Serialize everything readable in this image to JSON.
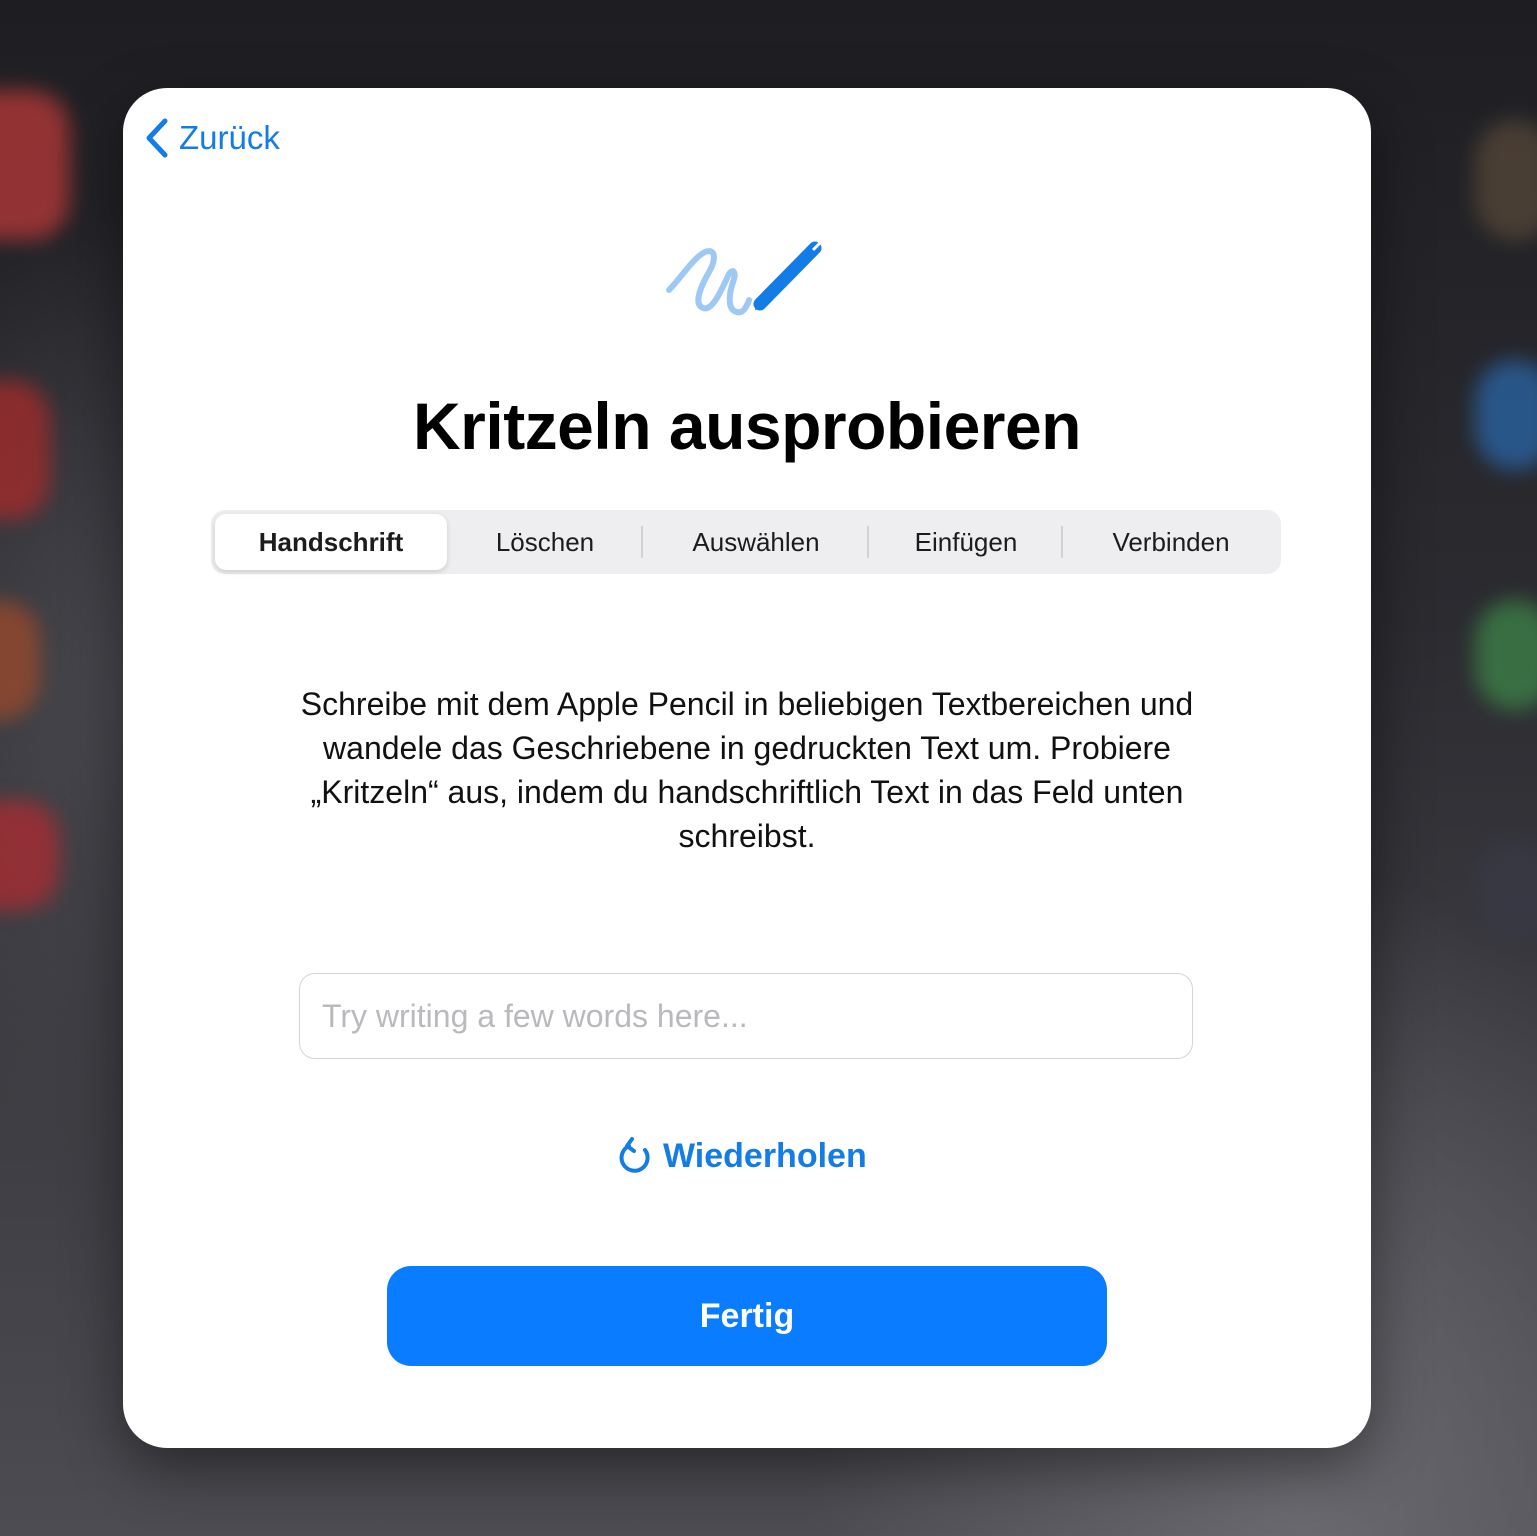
{
  "dialog": {
    "back_label": "Zurück",
    "icon": "scribble-pencil-icon",
    "title": "Kritzeln ausprobieren",
    "tabs": [
      {
        "label": "Handschrift",
        "selected": true
      },
      {
        "label": "Löschen",
        "selected": false
      },
      {
        "label": "Auswählen",
        "selected": false
      },
      {
        "label": "Einfügen",
        "selected": false
      },
      {
        "label": "Verbinden",
        "selected": false
      }
    ],
    "description": "Schreibe mit dem Apple Pencil in beliebigen Textbereichen und wandele das Geschriebene in gedruckten Text um. Probiere „Kritzeln“ aus, indem du handschriftlich Text in das Feld unten schreibst.",
    "input": {
      "value": "",
      "placeholder": "Try writing a few words here..."
    },
    "repeat_label": "Wiederholen",
    "repeat_icon": "arrow-counterclockwise-icon",
    "done_label": "Fertig"
  },
  "colors": {
    "accent": "#147ce6",
    "primary_button": "#0a7cff",
    "segment_bg": "#eeeef0",
    "placeholder": "#b9b9be"
  }
}
